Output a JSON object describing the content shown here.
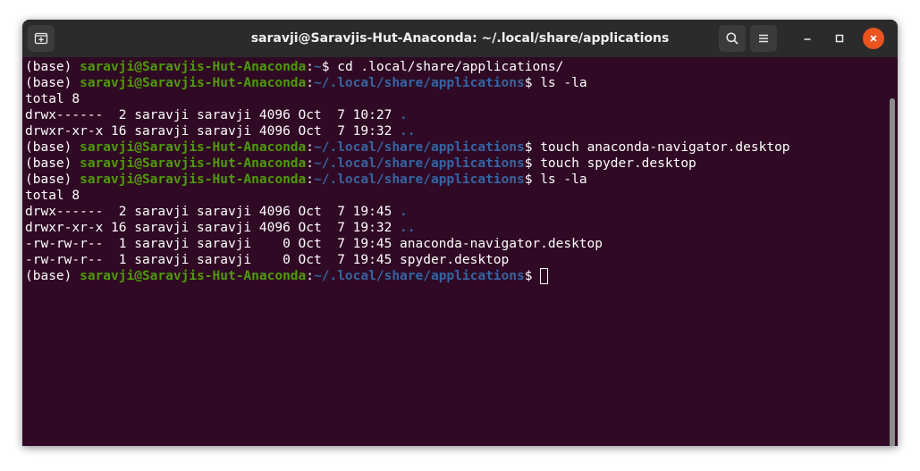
{
  "window": {
    "title": "saravji@Saravjis-Hut-Anaconda: ~/.local/share/applications"
  },
  "icons": {
    "new_tab": "new-tab-icon",
    "search": "search-icon",
    "menu": "hamburger-menu-icon",
    "minimize": "minimize-icon",
    "maximize": "maximize-icon",
    "close": "close-icon"
  },
  "colors": {
    "terminal_bg": "#300a24",
    "titlebar_bg": "#2b2b2b",
    "user_host": "#4e9a06",
    "path": "#3465a4",
    "text": "#ffffff",
    "close_button": "#e95420"
  },
  "terminal": {
    "lines": [
      {
        "env": "(base) ",
        "user_host": "saravji@Saravjis-Hut-Anaconda",
        "sep": ":",
        "path": "~",
        "prompt": "$ ",
        "command": "cd .local/share/applications/"
      },
      {
        "env": "(base) ",
        "user_host": "saravji@Saravjis-Hut-Anaconda",
        "sep": ":",
        "path": "~/.local/share/applications",
        "prompt": "$ ",
        "command": "ls -la"
      },
      {
        "text": "total 8"
      },
      {
        "text": "drwx------  2 saravji saravji 4096 Oct  7 10:27 ",
        "dir": "."
      },
      {
        "text": "drwxr-xr-x 16 saravji saravji 4096 Oct  7 19:32 ",
        "dir": ".."
      },
      {
        "env": "(base) ",
        "user_host": "saravji@Saravjis-Hut-Anaconda",
        "sep": ":",
        "path": "~/.local/share/applications",
        "prompt": "$ ",
        "command": "touch anaconda-navigator.desktop"
      },
      {
        "env": "(base) ",
        "user_host": "saravji@Saravjis-Hut-Anaconda",
        "sep": ":",
        "path": "~/.local/share/applications",
        "prompt": "$ ",
        "command": "touch spyder.desktop"
      },
      {
        "env": "(base) ",
        "user_host": "saravji@Saravjis-Hut-Anaconda",
        "sep": ":",
        "path": "~/.local/share/applications",
        "prompt": "$ ",
        "command": "ls -la"
      },
      {
        "text": "total 8"
      },
      {
        "text": "drwx------  2 saravji saravji 4096 Oct  7 19:45 ",
        "dir": "."
      },
      {
        "text": "drwxr-xr-x 16 saravji saravji 4096 Oct  7 19:32 ",
        "dir": ".."
      },
      {
        "text": "-rw-rw-r--  1 saravji saravji    0 Oct  7 19:45 anaconda-navigator.desktop"
      },
      {
        "text": "-rw-rw-r--  1 saravji saravji    0 Oct  7 19:45 spyder.desktop"
      },
      {
        "env": "(base) ",
        "user_host": "saravji@Saravjis-Hut-Anaconda",
        "sep": ":",
        "path": "~/.local/share/applications",
        "prompt": "$ ",
        "command": ""
      }
    ]
  }
}
